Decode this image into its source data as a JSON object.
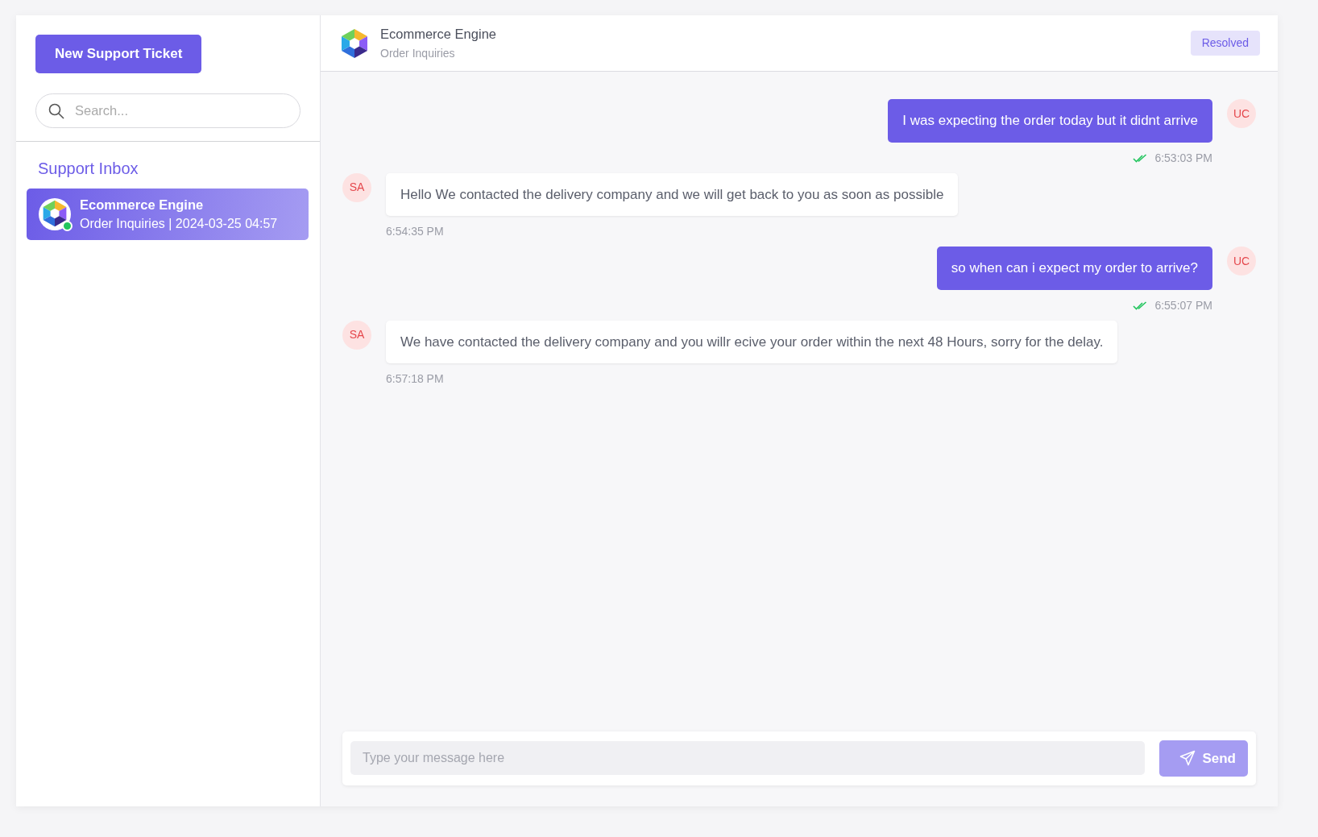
{
  "sidebar": {
    "new_ticket_button": "New Support Ticket",
    "search": {
      "placeholder": "Search..."
    },
    "inbox_title": "Support Inbox",
    "items": [
      {
        "title": "Ecommerce Engine",
        "subtitle": "Order Inquiries | 2024-03-25 04:57",
        "selected": true,
        "online": true
      }
    ]
  },
  "header": {
    "title": "Ecommerce Engine",
    "subtitle": "Order Inquiries",
    "status": "Resolved"
  },
  "messages": [
    {
      "kind": "user",
      "avatar": "UC",
      "text": "I was expecting the order today but it didnt arrive",
      "time": "6:53:03 PM",
      "read": true
    },
    {
      "kind": "agent",
      "avatar": "SA",
      "text": "Hello We contacted the delivery company and we will get back to you as soon as possible",
      "time": "6:54:35 PM",
      "read": false
    },
    {
      "kind": "user",
      "avatar": "UC",
      "text": "so when can i expect my order to arrive?",
      "time": "6:55:07 PM",
      "read": true
    },
    {
      "kind": "agent",
      "avatar": "SA",
      "text": "We have contacted the delivery company and you willr ecive your order within the next 48 Hours, sorry for the delay.",
      "time": "6:57:18 PM",
      "read": false
    }
  ],
  "composer": {
    "placeholder": "Type your message here",
    "send_button": "Send",
    "send_disabled": true
  }
}
